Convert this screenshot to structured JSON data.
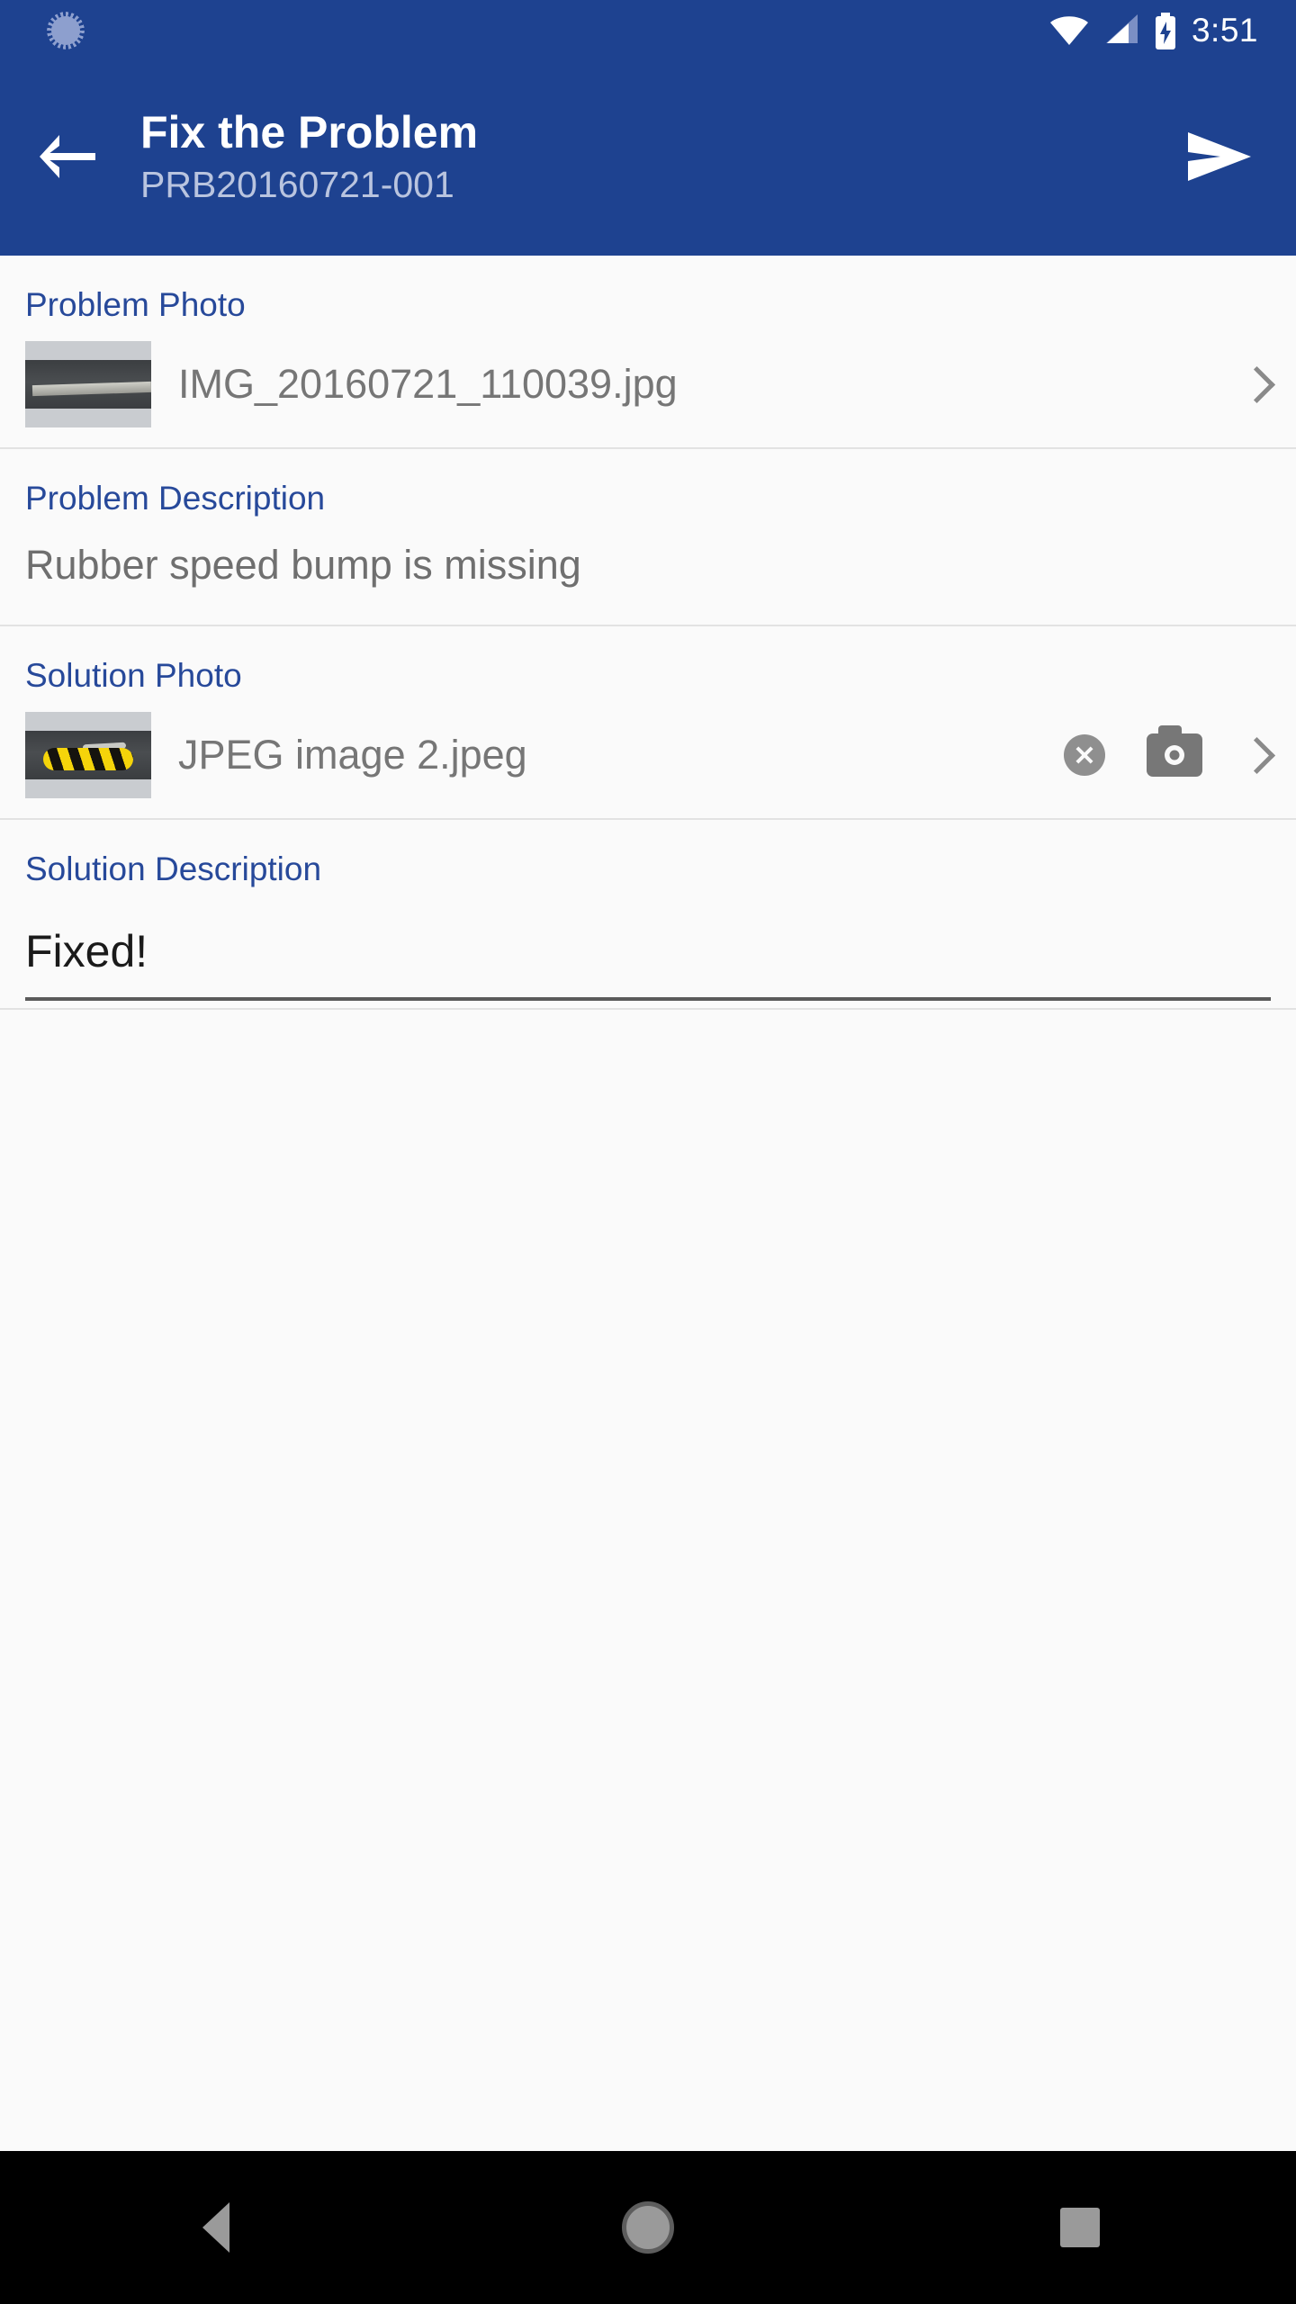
{
  "status_bar": {
    "time": "3:51",
    "icons": [
      "notification-spinner-icon",
      "wifi-icon",
      "cellular-signal-icon",
      "battery-charging-icon"
    ]
  },
  "toolbar": {
    "back_icon": "back-arrow-icon",
    "title": "Fix the Problem",
    "subtitle": "PRB20160721-001",
    "send_icon": "send-icon",
    "background_color": "#1e4290"
  },
  "sections": {
    "problem_photo": {
      "label": "Problem Photo",
      "file_name": "IMG_20160721_110039.jpg",
      "chevron_icon": "chevron-right-icon"
    },
    "problem_description": {
      "label": "Problem Description",
      "value": "Rubber speed bump is missing"
    },
    "solution_photo": {
      "label": "Solution Photo",
      "file_name": "JPEG image 2.jpeg",
      "clear_icon": "clear-circle-icon",
      "camera_icon": "camera-icon",
      "chevron_icon": "chevron-right-icon"
    },
    "solution_description": {
      "label": "Solution Description",
      "value": "Fixed!",
      "placeholder": ""
    }
  },
  "nav_bar": {
    "back_label": "Back",
    "home_label": "Home",
    "recents_label": "Recents"
  },
  "colors": {
    "primary": "#1e4290",
    "label_blue": "#27499a",
    "body_gray": "#767676",
    "page_bg": "#fafafa"
  }
}
